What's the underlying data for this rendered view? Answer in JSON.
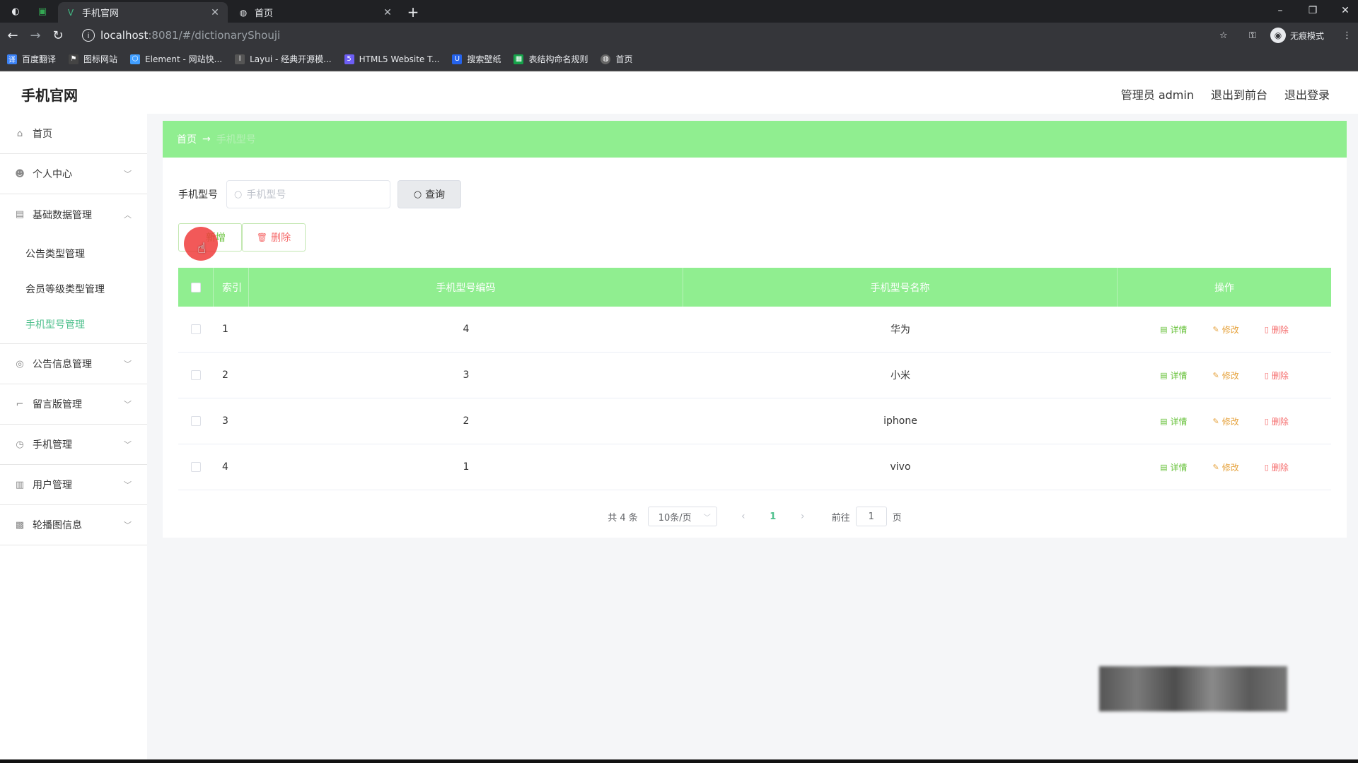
{
  "browser": {
    "tabs": [
      {
        "label": "手机官网",
        "active": true
      },
      {
        "label": "首页",
        "active": false
      }
    ],
    "url_host": "localhost",
    "url_path": ":8081/#/dictionaryShouji",
    "incognito_label": "无痕模式",
    "bookmarks": [
      {
        "label": "百度翻译",
        "icon": "translate-icon",
        "color": "#3b82f6"
      },
      {
        "label": "图标网站",
        "icon": "flag-icon",
        "color": "#444"
      },
      {
        "label": "Element - 网站快...",
        "icon": "element-icon",
        "color": "#409eff"
      },
      {
        "label": "Layui - 经典开源模...",
        "icon": "layui-icon",
        "color": "#555"
      },
      {
        "label": "HTML5 Website T...",
        "icon": "html5-icon",
        "color": "#6d5ef5"
      },
      {
        "label": "搜索壁纸",
        "icon": "wallpaper-icon",
        "color": "#2563eb"
      },
      {
        "label": "表结构命名规则",
        "icon": "sheet-icon",
        "color": "#16a34a"
      },
      {
        "label": "首页",
        "icon": "globe-icon",
        "color": "#666"
      }
    ]
  },
  "app": {
    "title": "手机官网",
    "top_links": [
      "管理员 admin",
      "退出到前台",
      "退出登录"
    ]
  },
  "sidebar": {
    "items": [
      {
        "label": "首页",
        "icon": "home-icon",
        "chevron": false
      },
      {
        "label": "个人中心",
        "icon": "user-icon",
        "chevron": true
      },
      {
        "label": "基础数据管理",
        "icon": "clipboard-icon",
        "chevron": true,
        "open": true,
        "children": [
          "公告类型管理",
          "会员等级类型管理",
          "手机型号管理"
        ],
        "active_child": 2
      },
      {
        "label": "公告信息管理",
        "icon": "globe-icon",
        "chevron": true
      },
      {
        "label": "留言版管理",
        "icon": "crop-icon",
        "chevron": true
      },
      {
        "label": "手机管理",
        "icon": "compass-icon",
        "chevron": true
      },
      {
        "label": "用户管理",
        "icon": "bar-chart-icon",
        "chevron": true
      },
      {
        "label": "轮播图信息",
        "icon": "picture-icon",
        "chevron": true
      }
    ]
  },
  "breadcrumb": {
    "home": "首页",
    "arrow": "→",
    "current": "手机型号"
  },
  "search": {
    "label": "手机型号",
    "placeholder": "手机型号",
    "button": "查询"
  },
  "actions": {
    "add": "新增",
    "delete": "删除"
  },
  "table": {
    "headers": {
      "index": "索引",
      "code": "手机型号编码",
      "name": "手机型号名称",
      "ops": "操作"
    },
    "rows": [
      {
        "index": "1",
        "code": "4",
        "name": "华为"
      },
      {
        "index": "2",
        "code": "3",
        "name": "小米"
      },
      {
        "index": "3",
        "code": "2",
        "name": "iphone"
      },
      {
        "index": "4",
        "code": "1",
        "name": "vivo"
      }
    ],
    "op_labels": {
      "detail": "详情",
      "edit": "修改",
      "delete": "删除"
    }
  },
  "pagination": {
    "total": "共 4 条",
    "page_size": "10条/页",
    "current": "1",
    "goto_label": "前往",
    "goto_value": "1",
    "page_suffix": "页"
  },
  "colors": {
    "accent_green": "#90ee90",
    "active_text": "#4fc08d",
    "danger": "#f56c6c",
    "warning": "#e6a23c"
  }
}
